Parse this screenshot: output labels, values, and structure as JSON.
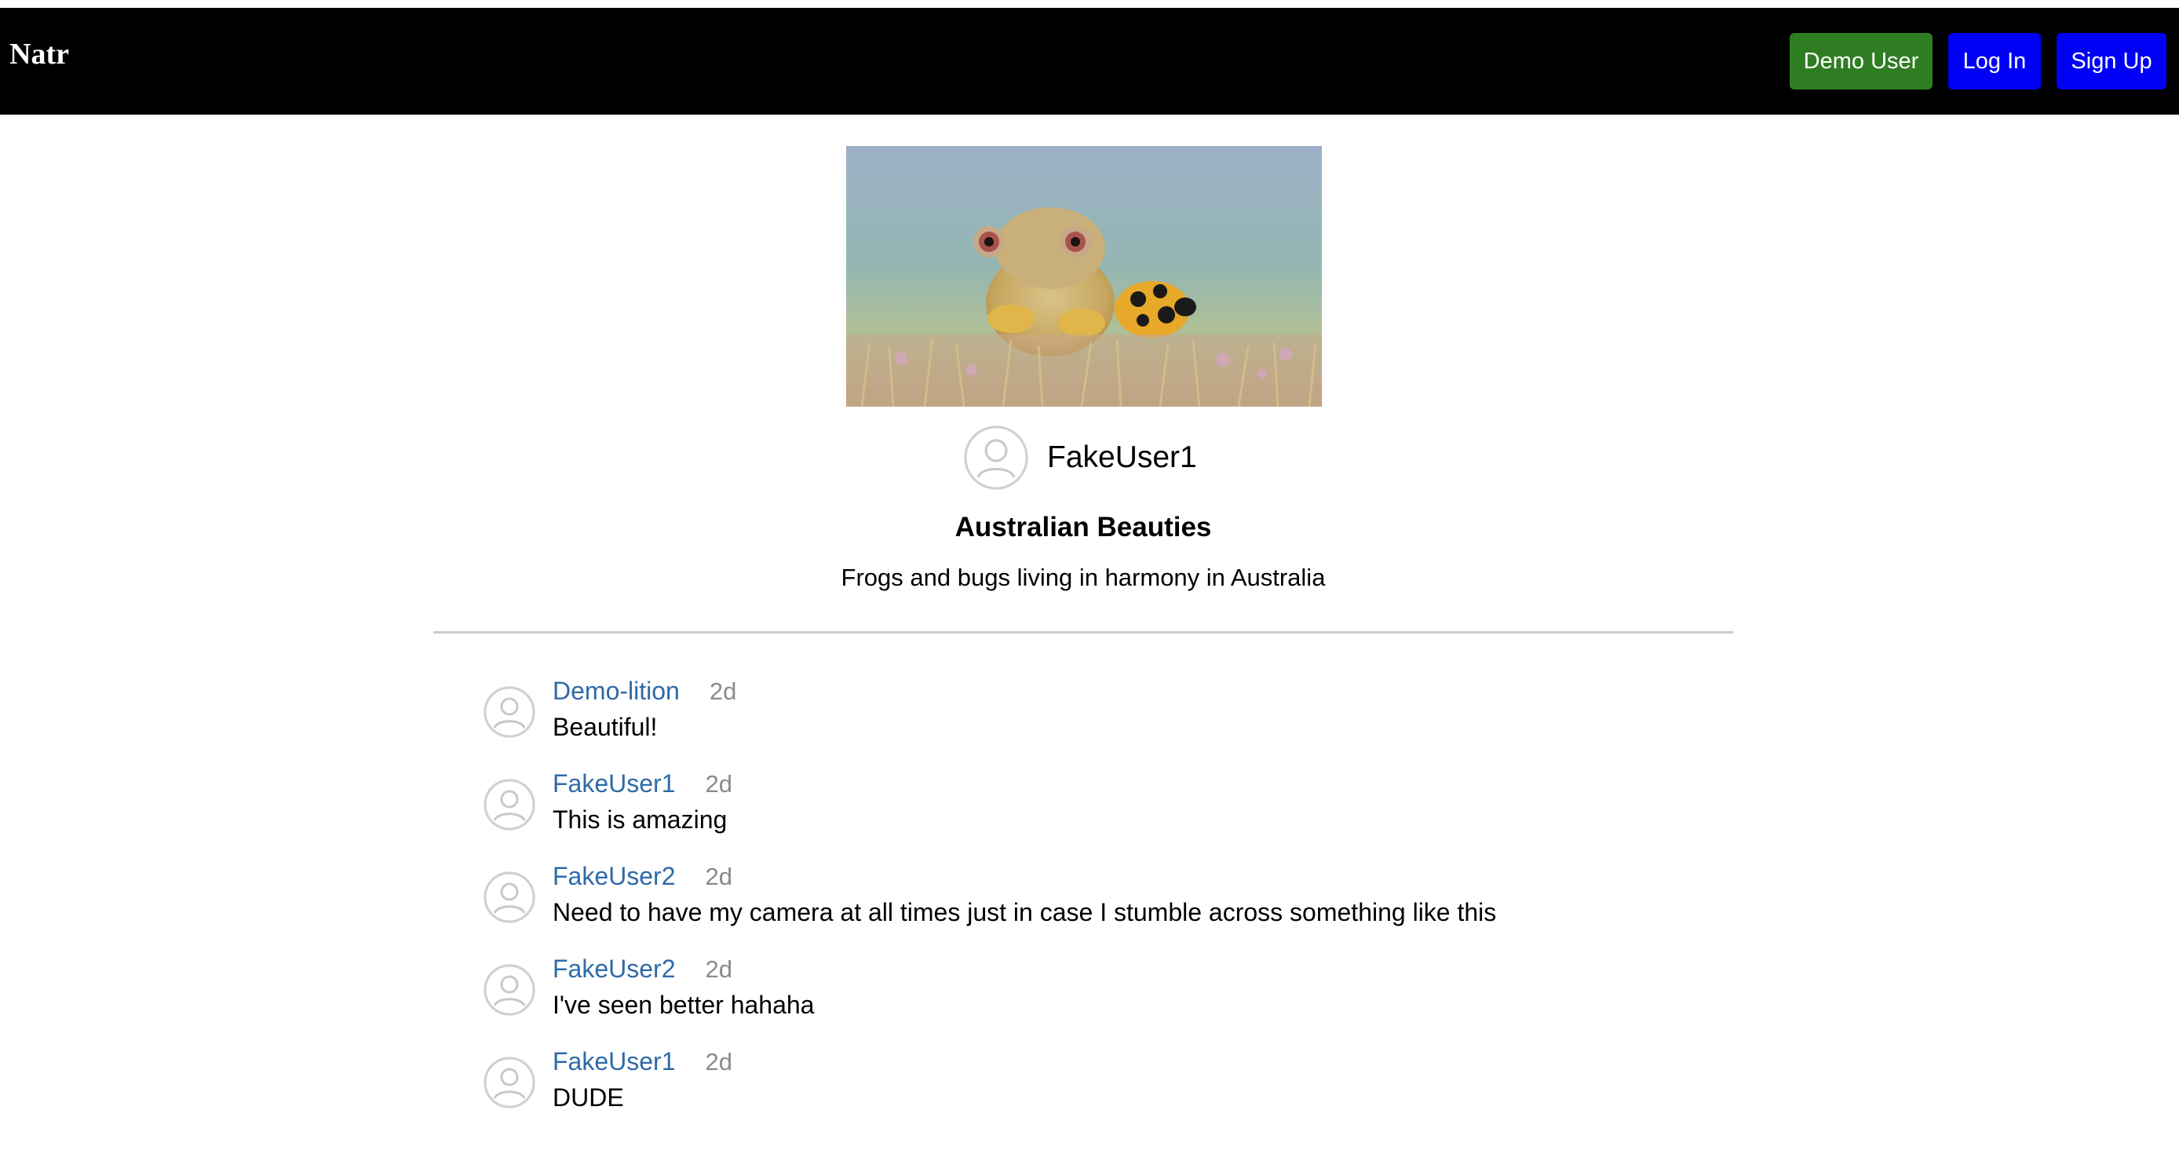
{
  "navbar": {
    "brand": "Natr",
    "buttons": {
      "demo_user": "Demo User",
      "log_in": "Log In",
      "sign_up": "Sign Up"
    }
  },
  "post": {
    "author": "FakeUser1",
    "title": "Australian Beauties",
    "description": "Frogs and bugs living in harmony in Australia"
  },
  "comments": [
    {
      "user": "Demo-lition",
      "time": "2d",
      "text": "Beautiful!"
    },
    {
      "user": "FakeUser1",
      "time": "2d",
      "text": "This is amazing"
    },
    {
      "user": "FakeUser2",
      "time": "2d",
      "text": "Need to have my camera at all times just in case I stumble across something like this"
    },
    {
      "user": "FakeUser2",
      "time": "2d",
      "text": "I've seen better hahaha"
    },
    {
      "user": "FakeUser1",
      "time": "2d",
      "text": "DUDE"
    }
  ],
  "colors": {
    "navbar_bg": "#000000",
    "demo_button": "#2f7d22",
    "auth_buttons": "#0000f7",
    "comment_user": "#2e6aa8",
    "timestamp": "#8a8a8a"
  },
  "icons": {
    "avatar": "default-user-avatar-icon"
  }
}
